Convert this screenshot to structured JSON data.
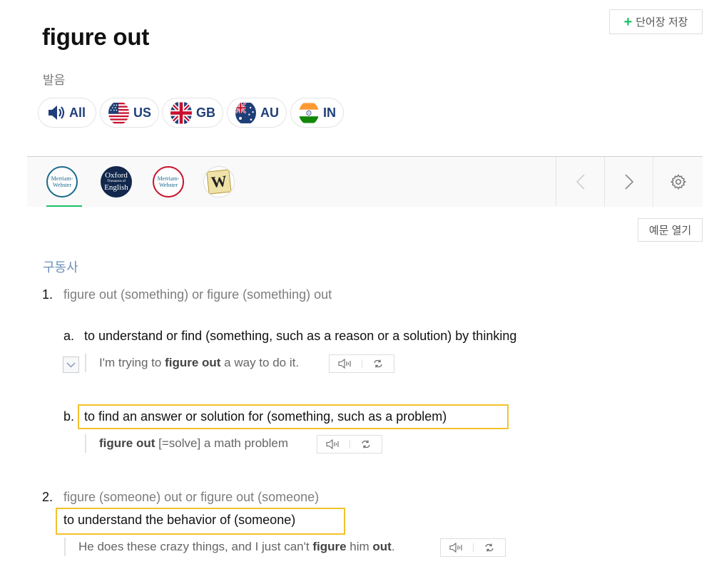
{
  "entry": {
    "title": "figure out",
    "save_label": "단어장 저장"
  },
  "pronunciation": {
    "label": "발음",
    "buttons": [
      {
        "code": "All",
        "icon": "speaker-icon"
      },
      {
        "code": "US",
        "icon": "us-flag-icon"
      },
      {
        "code": "GB",
        "icon": "gb-flag-icon"
      },
      {
        "code": "AU",
        "icon": "au-flag-icon"
      },
      {
        "code": "IN",
        "icon": "in-flag-icon"
      }
    ]
  },
  "dictionaries": {
    "tabs": [
      {
        "line1": "Merriam-",
        "line2": "Webster"
      },
      {
        "line1": "Oxford",
        "line2": "Thesaurus of",
        "line3": "English"
      },
      {
        "line1": "Merriam-",
        "line2": "Webster"
      },
      {
        "line1": "W"
      }
    ],
    "active_index": 0
  },
  "examples_toggle_label": "예문 열기",
  "content": {
    "part_of_speech": "구동사",
    "senses": [
      {
        "number": "1.",
        "phrase": "figure out (something) or figure (something) out",
        "subsenses": [
          {
            "letter": "a.",
            "definition": "to understand or find (something, such as a reason or a solution) by thinking",
            "highlighted": false,
            "example": {
              "before": "I'm trying to ",
              "bold1": "figure out",
              "after": " a way to do it."
            }
          },
          {
            "letter": "b.",
            "definition": "to find an answer or solution for (something, such as a problem)",
            "highlighted": true,
            "example": {
              "bold1": "figure out",
              "after": " [=solve] a math problem"
            }
          }
        ]
      },
      {
        "number": "2.",
        "phrase": "figure (someone) out or figure out (someone)",
        "definition": "to understand the behavior of (someone)",
        "highlighted": true,
        "example": {
          "before": "He does these crazy things, and I just can't ",
          "bold1": "figure",
          "middle": " him ",
          "bold2": "out",
          "after": "."
        }
      }
    ]
  },
  "colors": {
    "accent": "#19c064",
    "highlight": "#f3c22b",
    "pos": "#6e8fbc",
    "flag_text": "#1f3f78"
  }
}
